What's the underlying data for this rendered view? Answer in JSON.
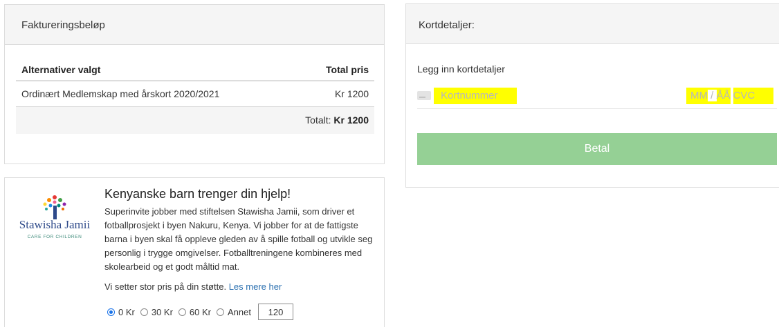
{
  "billing": {
    "header": "Faktureringsbeløp",
    "columns": [
      "Alternativer valgt",
      "Total pris"
    ],
    "rows": [
      {
        "item": "Ordinært Medlemskap med årskort 2020/2021",
        "price": "Kr 1200"
      }
    ],
    "total_label": "Totalt:",
    "total_value": "Kr 1200"
  },
  "card": {
    "header": "Kortdetaljer:",
    "instruction": "Legg inn kortdetaljer",
    "number_placeholder": "Kortnummer",
    "expiry_mm": "MM",
    "expiry_sep": " / ",
    "expiry_yy": "ÅÅ",
    "cvc": "CVC",
    "pay_label": "Betal",
    "highlight_color": "#ffff00",
    "pay_color": "#95d095"
  },
  "charity": {
    "logo_name": "Stawisha Jamii",
    "logo_tagline": "CARE FOR CHILDREN",
    "title": "Kenyanske barn trenger din hjelp!",
    "body": "Superinvite jobber med stiftelsen Stawisha Jamii, som driver et fotballprosjekt i byen Nakuru, Kenya. Vi jobber for at de fattigste barna i byen skal få oppleve gleden av å spille fotball og utvikle seg personlig i trygge omgivelser. Fotballtreningene kombineres med skolearbeid og et godt måltid mat.",
    "note": "Vi setter stor pris på din støtte.",
    "link": "Les mere her",
    "options": [
      "0 Kr",
      "30 Kr",
      "60 Kr",
      "Annet"
    ],
    "selected": "0 Kr",
    "other_amount": "120"
  }
}
